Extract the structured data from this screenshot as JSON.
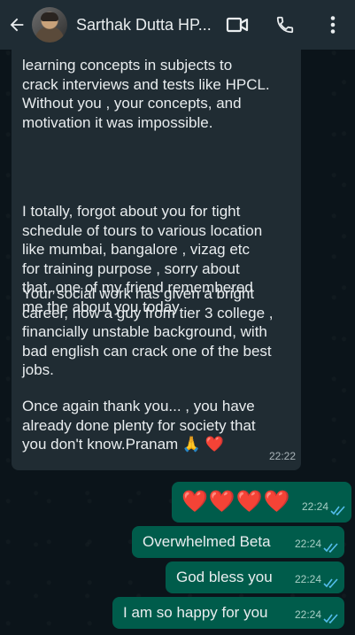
{
  "header": {
    "contact_name": "Sarthak Dutta HP...",
    "back_icon": "back-arrow-icon",
    "video_icon": "video-call-icon",
    "call_icon": "phone-icon",
    "menu_icon": "more-vert-icon"
  },
  "incoming": {
    "paragraphs": [
      "learning concepts in subjects to\ncrack interviews and tests like HPCL.\nWithout you , your concepts, and\nmotivation it was impossible.",
      "I totally, forgot about you for tight\nschedule of tours to various location\nlike mumbai, bangalore , vizag etc\nfor training purpose , sorry about\nthat ,one of my friend remembered\nme the about you  today .",
      "Your social work has given a bright\ncareer, now a guy from tier 3 college ,\nfinancially unstable background, with\nbad english can crack one of the best\njobs.",
      "Once again thank you... , you have\nalready done plenty for society that\nyou don't know.Pranam 🙏 ❤️"
    ],
    "time": "22:22"
  },
  "outgoing": [
    {
      "text": "❤️❤️❤️❤️",
      "time": "22:24",
      "status": "read"
    },
    {
      "text": "Overwhelmed Beta",
      "time": "22:24",
      "status": "read"
    },
    {
      "text": "God bless you",
      "time": "22:24",
      "status": "read"
    },
    {
      "text": "I am so happy for you",
      "time": "22:24",
      "status": "read"
    }
  ],
  "colors": {
    "background": "#0b141a",
    "header": "#1f2c34",
    "incoming_bubble": "#202c33",
    "outgoing_bubble": "#005c4b",
    "read_ticks": "#53bdeb"
  }
}
